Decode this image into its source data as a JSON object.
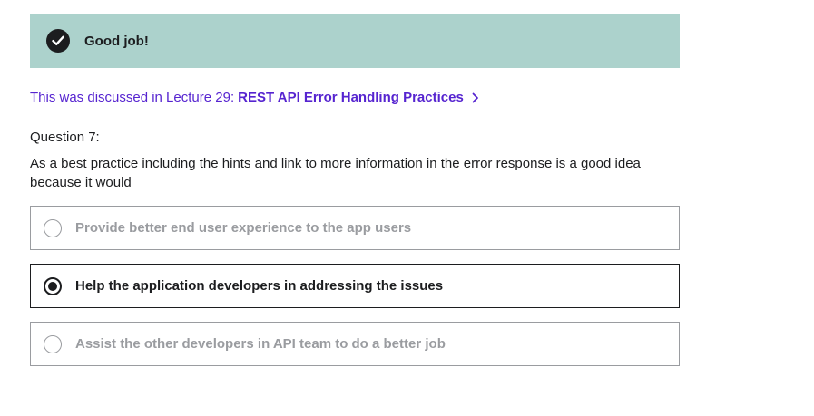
{
  "banner": {
    "message": "Good job!",
    "icon": "check-circle-icon",
    "bg_color": "#acd2cc"
  },
  "lecture_link": {
    "prefix": "This was discussed in Lecture 29:",
    "title": "REST API Error Handling Practices",
    "icon": "chevron-right-icon",
    "color": "#5624d0"
  },
  "question": {
    "number_label": "Question 7:",
    "text": "As a best practice including the hints and link to more information in the error response is a good idea because it would"
  },
  "options": [
    {
      "label": "Provide better end user experience to the app users",
      "selected": false
    },
    {
      "label": "Help the application developers in addressing the issues",
      "selected": true
    },
    {
      "label": "Assist the other developers in API team to do a better job",
      "selected": false
    }
  ]
}
